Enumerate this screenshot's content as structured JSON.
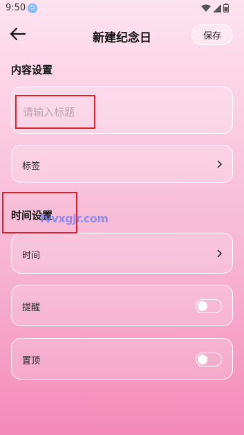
{
  "status_bar": {
    "time": "9:50"
  },
  "header": {
    "title": "新建纪念日",
    "save_label": "保存"
  },
  "content_section": {
    "title": "内容设置",
    "title_placeholder": "请输入标题",
    "tag_label": "标签"
  },
  "time_section": {
    "title": "时间设置",
    "time_label": "时间",
    "reminder_label": "提醒",
    "pin_label": "置顶"
  },
  "toggles": {
    "reminder_on": false,
    "pin_on": false
  },
  "watermark": "fvvxgjr.com",
  "icons": [
    "back-arrow-icon",
    "chevron-right-icon",
    "wifi-icon",
    "signal-icon",
    "battery-icon"
  ],
  "colors": {
    "annotation_red": "#e01d2a",
    "background_top": "#fde3ef",
    "background_bottom": "#f48ab8"
  }
}
